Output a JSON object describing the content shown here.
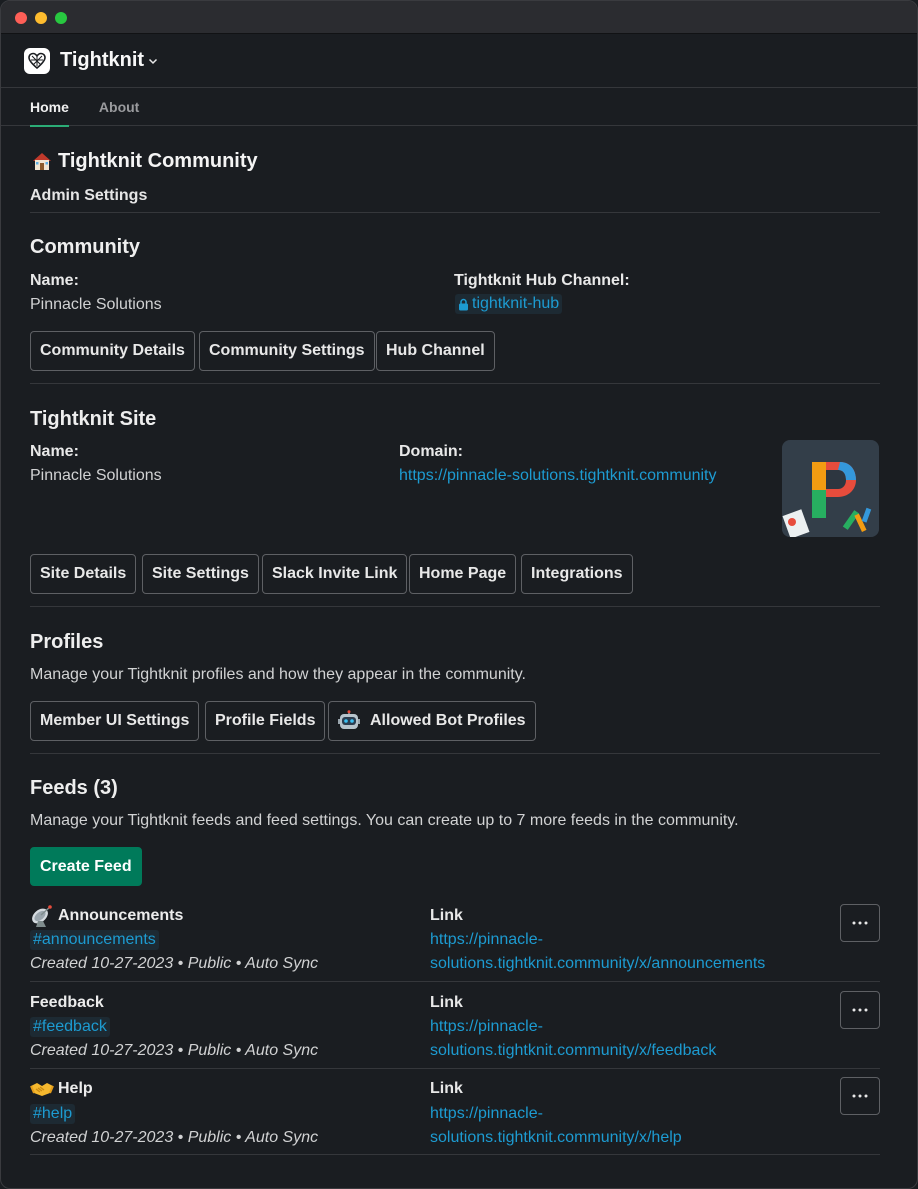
{
  "app": {
    "name": "Tightknit"
  },
  "tabs": [
    {
      "label": "Home"
    },
    {
      "label": "About"
    }
  ],
  "page": {
    "title": "Tightknit Community",
    "subtitle": "Admin Settings"
  },
  "community": {
    "heading": "Community",
    "name_label": "Name:",
    "name_value": "Pinnacle Solutions",
    "hub_label": "Tightknit Hub Channel:",
    "hub_channel": "tightknit-hub",
    "buttons": [
      "Community Details",
      "Community Settings",
      "Hub Channel"
    ]
  },
  "site": {
    "heading": "Tightknit Site",
    "name_label": "Name:",
    "name_value": "Pinnacle Solutions",
    "domain_label": "Domain:",
    "domain_value": "https://pinnacle-solutions.tightknit.community",
    "buttons": [
      "Site Details",
      "Site Settings",
      "Slack Invite Link",
      "Home Page",
      "Integrations"
    ]
  },
  "profiles": {
    "heading": "Profiles",
    "description": "Manage your Tightknit profiles and how they appear in the community.",
    "buttons": [
      "Member UI Settings",
      "Profile Fields",
      "Allowed Bot Profiles"
    ]
  },
  "feeds": {
    "heading": "Feeds (3)",
    "description": "Manage your Tightknit feeds and feed settings. You can create up to 7 more feeds in the community.",
    "create_button": "Create Feed",
    "link_label": "Link",
    "items": [
      {
        "title": "Announcements",
        "icon": "satellite-dish-icon",
        "channel": "#announcements",
        "meta": "Created 10-27-2023 • Public • Auto Sync",
        "link_line1": "https://pinnacle-",
        "link_line2": "solutions.tightknit.community/x/announcements"
      },
      {
        "title": "Feedback",
        "icon": "",
        "channel": "#feedback",
        "meta": "Created 10-27-2023 • Public • Auto Sync",
        "link_line1": "https://pinnacle-",
        "link_line2": "solutions.tightknit.community/x/feedback"
      },
      {
        "title": "Help",
        "icon": "handshake-icon",
        "channel": "#help",
        "meta": "Created 10-27-2023 • Public • Auto Sync",
        "link_line1": "https://pinnacle-",
        "link_line2": "solutions.tightknit.community/x/help"
      }
    ]
  },
  "colors": {
    "background": "#1a1d21",
    "link": "#1d9bd1",
    "accent": "#2bac76",
    "primary_button": "#007a5a"
  }
}
